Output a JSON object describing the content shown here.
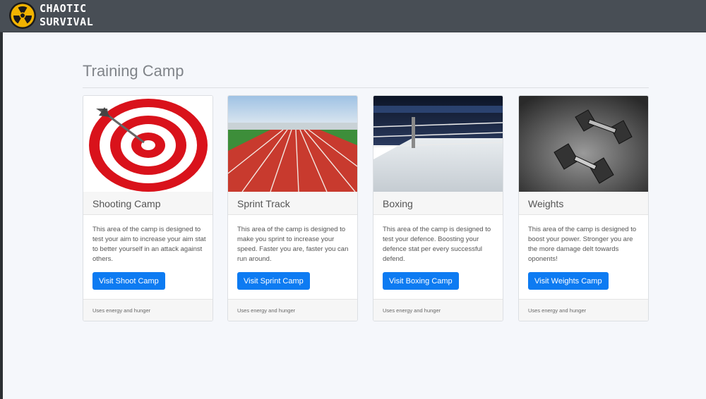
{
  "header": {
    "brand_line1": "CHAOTIC",
    "brand_line2": "SURVIVAL",
    "logo_icon": "radiation-icon",
    "colors": {
      "bar": "#484e55",
      "logo_yellow": "#f2b300"
    }
  },
  "page": {
    "title": "Training Camp"
  },
  "cards": [
    {
      "image_icon": "target-icon",
      "title": "Shooting Camp",
      "text": "This area of the camp is designed to test your aim to increase your aim stat to better yourself in an attack against others.",
      "button": "Visit Shoot Camp",
      "footer": "Uses energy and hunger"
    },
    {
      "image_icon": "running-track-icon",
      "title": "Sprint Track",
      "text": "This area of the camp is designed to make you sprint to increase your speed. Faster you are, faster you can run around.",
      "button": "Visit Sprint Camp",
      "footer": "Uses energy and hunger"
    },
    {
      "image_icon": "boxing-ring-icon",
      "title": "Boxing",
      "text": "This area of the camp is designed to test your defence. Boosting your defence stat per every successful defend.",
      "button": "Visit Boxing Camp",
      "footer": "Uses energy and hunger"
    },
    {
      "image_icon": "dumbbell-icon",
      "title": "Weights",
      "text": "This area of the camp is designed to boost your power. Stronger you are the more damage delt towards oponents!",
      "button": "Visit Weights Camp",
      "footer": "Uses energy and hunger"
    }
  ],
  "theme": {
    "primary": "#0d7bf2"
  }
}
